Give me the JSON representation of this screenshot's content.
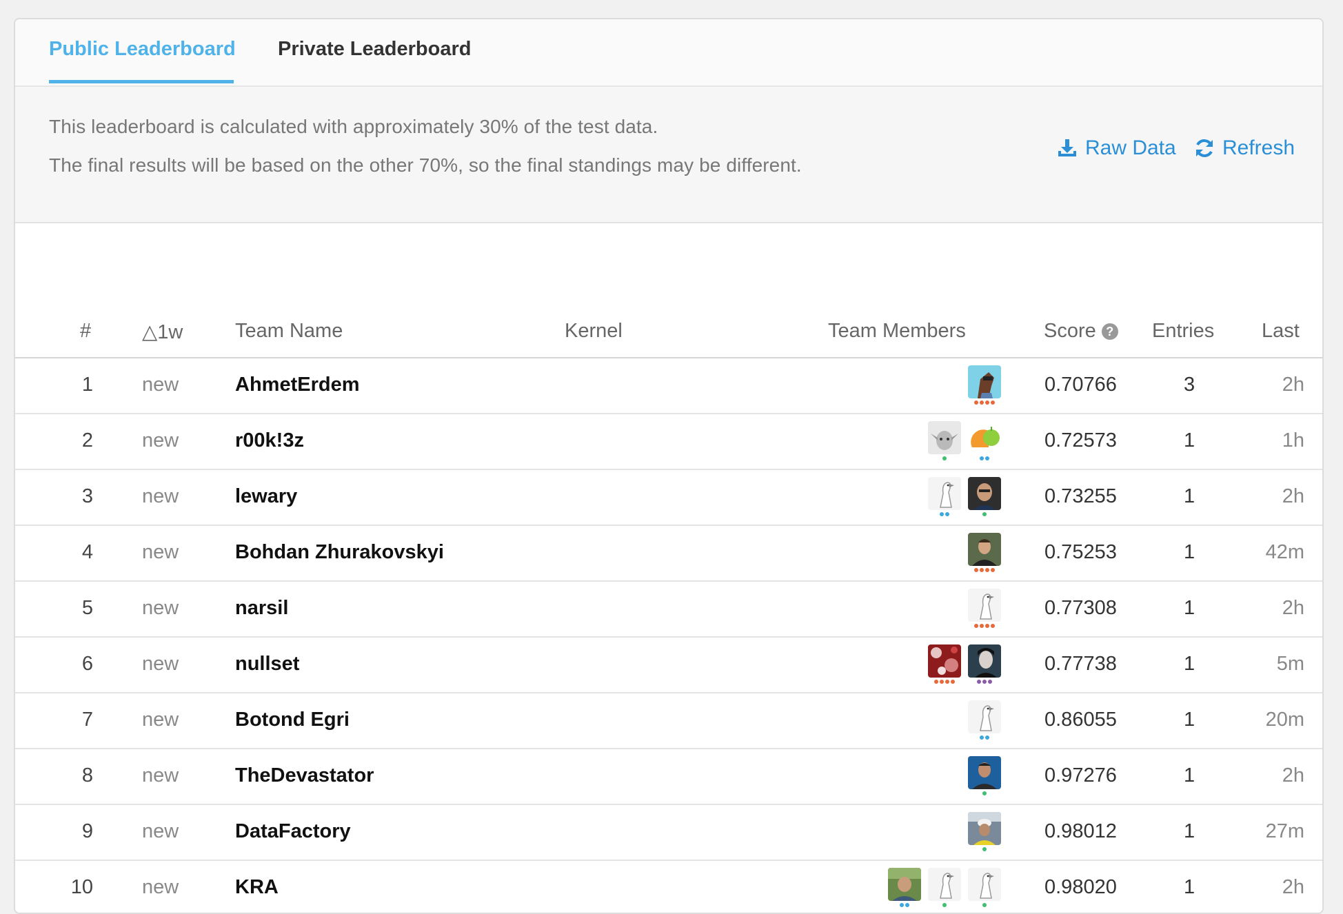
{
  "tabs": {
    "public": "Public Leaderboard",
    "private": "Private Leaderboard"
  },
  "info": {
    "line1": "This leaderboard is calculated with approximately 30% of the test data.",
    "line2": "The final results will be based on the other 70%, so the final standings may be different.",
    "raw_data": "Raw Data",
    "refresh": "Refresh"
  },
  "columns": {
    "rank": "#",
    "delta": "△1w",
    "team": "Team Name",
    "kernel": "Kernel",
    "members": "Team Members",
    "score": "Score",
    "entries": "Entries",
    "last": "Last"
  },
  "colors": {
    "accent": "#4fb3ea",
    "link": "#2a8fd6",
    "tier_orange": "#e86a3a",
    "tier_blue": "#3aa8e0",
    "tier_green": "#3fbf6f",
    "tier_purple": "#8a5ca8"
  },
  "rows": [
    {
      "rank": "1",
      "delta": "new",
      "team": "AhmetErdem",
      "score": "0.70766",
      "entries": "3",
      "last": "2h",
      "members": [
        {
          "avatar": "horse-cartoon",
          "tier": "grandmaster"
        }
      ]
    },
    {
      "rank": "2",
      "delta": "new",
      "team": "r00k!3z",
      "score": "0.72573",
      "entries": "1",
      "last": "1h",
      "members": [
        {
          "avatar": "yoda",
          "tier": "novice"
        },
        {
          "avatar": "orange-apple",
          "tier": "expert"
        }
      ]
    },
    {
      "rank": "3",
      "delta": "new",
      "team": "lewary",
      "score": "0.73255",
      "entries": "1",
      "last": "2h",
      "members": [
        {
          "avatar": "goose",
          "tier": "expert"
        },
        {
          "avatar": "man-face",
          "tier": "novice"
        }
      ]
    },
    {
      "rank": "4",
      "delta": "new",
      "team": "Bohdan Zhurakovskyi",
      "score": "0.75253",
      "entries": "1",
      "last": "42m",
      "members": [
        {
          "avatar": "man-portrait",
          "tier": "grandmaster"
        }
      ]
    },
    {
      "rank": "5",
      "delta": "new",
      "team": "narsil",
      "score": "0.77308",
      "entries": "1",
      "last": "2h",
      "members": [
        {
          "avatar": "goose",
          "tier": "grandmaster"
        }
      ]
    },
    {
      "rank": "6",
      "delta": "new",
      "team": "nullset",
      "score": "0.77738",
      "entries": "1",
      "last": "5m",
      "members": [
        {
          "avatar": "red-pattern",
          "tier": "grandmaster"
        },
        {
          "avatar": "woman-portrait",
          "tier": "master"
        }
      ]
    },
    {
      "rank": "7",
      "delta": "new",
      "team": "Botond Egri",
      "score": "0.86055",
      "entries": "1",
      "last": "20m",
      "members": [
        {
          "avatar": "goose",
          "tier": "expert"
        }
      ]
    },
    {
      "rank": "8",
      "delta": "new",
      "team": "TheDevastator",
      "score": "0.97276",
      "entries": "1",
      "last": "2h",
      "members": [
        {
          "avatar": "man-blue",
          "tier": "novice"
        }
      ]
    },
    {
      "rank": "9",
      "delta": "new",
      "team": "DataFactory",
      "score": "0.98012",
      "entries": "1",
      "last": "27m",
      "members": [
        {
          "avatar": "worker-helmet",
          "tier": "novice"
        }
      ]
    },
    {
      "rank": "10",
      "delta": "new",
      "team": "KRA",
      "score": "0.98020",
      "entries": "1",
      "last": "2h",
      "members": [
        {
          "avatar": "man-outdoor",
          "tier": "expert"
        },
        {
          "avatar": "goose",
          "tier": "novice"
        },
        {
          "avatar": "goose",
          "tier": "novice"
        }
      ]
    }
  ]
}
